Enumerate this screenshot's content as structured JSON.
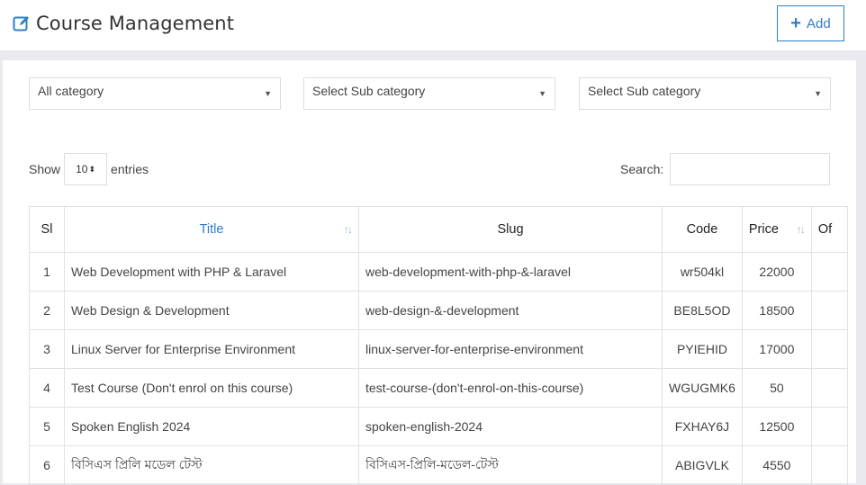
{
  "header": {
    "title": "Course Management",
    "add_label": "Add"
  },
  "filters": [
    {
      "label": "All category"
    },
    {
      "label": "Select Sub category"
    },
    {
      "label": "Select Sub category"
    }
  ],
  "length": {
    "show": "Show",
    "value": "10",
    "entries": "entries"
  },
  "search": {
    "label": "Search:"
  },
  "table": {
    "columns": [
      "Sl",
      "Title",
      "Slug",
      "Code",
      "Price",
      "Of"
    ],
    "rows": [
      {
        "sl": "1",
        "title": "Web Development with PHP & Laravel",
        "slug": "web-development-with-php-&-laravel",
        "code": "wr504kl",
        "price": "22000"
      },
      {
        "sl": "2",
        "title": "Web Design & Development",
        "slug": "web-design-&-development",
        "code": "BE8L5OD",
        "price": "18500"
      },
      {
        "sl": "3",
        "title": "Linux Server for Enterprise Environment",
        "slug": "linux-server-for-enterprise-environment",
        "code": "PYIEHID",
        "price": "17000"
      },
      {
        "sl": "4",
        "title": "Test Course (Don't enrol on this course)",
        "slug": "test-course-(don't-enrol-on-this-course)",
        "code": "WGUGMK6",
        "price": "50"
      },
      {
        "sl": "5",
        "title": "Spoken English 2024",
        "slug": "spoken-english-2024",
        "code": "FXHAY6J",
        "price": "12500"
      },
      {
        "sl": "6",
        "title": "বিসিএস প্রিলি মডেল টেস্ট",
        "slug": "বিসিএস-প্রিলি-মডেল-টেস্ট",
        "code": "ABIGVLK",
        "price": "4550"
      }
    ]
  },
  "colors": {
    "accent": "#2d7ec9",
    "background": "#e9e9ef"
  }
}
